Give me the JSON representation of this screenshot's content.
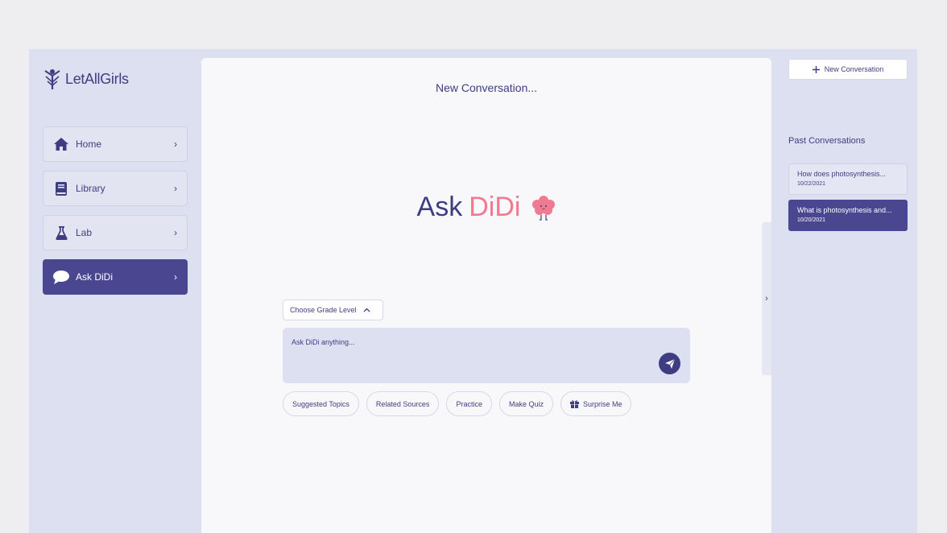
{
  "sidebar": {
    "logo_text": "LetAllGirls",
    "items": [
      {
        "label": "Home",
        "icon": "home-icon"
      },
      {
        "label": "Library",
        "icon": "book-icon"
      },
      {
        "label": "Lab",
        "icon": "flask-icon"
      },
      {
        "label": "Ask DiDi",
        "icon": "chat-bubble-icon"
      }
    ],
    "chevron": "›"
  },
  "main": {
    "title": "New Conversation...",
    "hero_ask": "Ask",
    "hero_didi": "DiDi",
    "grade_label": "Choose Grade Level",
    "input_placeholder": "Ask DiDi anything...",
    "chips": [
      "Suggested Topics",
      "Related Sources",
      "Practice",
      "Make Quiz",
      "Surprise Me"
    ]
  },
  "right": {
    "new_conversation": "New Conversation",
    "past_title": "Past Conversations",
    "conversations": [
      {
        "title": "How does photosynthesis...",
        "date": "10/22/2021"
      },
      {
        "title": "What is photosynthesis and...",
        "date": "10/20/2021"
      }
    ]
  },
  "colors": {
    "accent": "#4a4690",
    "text": "#3f3d82",
    "pink": "#f07a8f",
    "panel": "#dde0f0"
  }
}
